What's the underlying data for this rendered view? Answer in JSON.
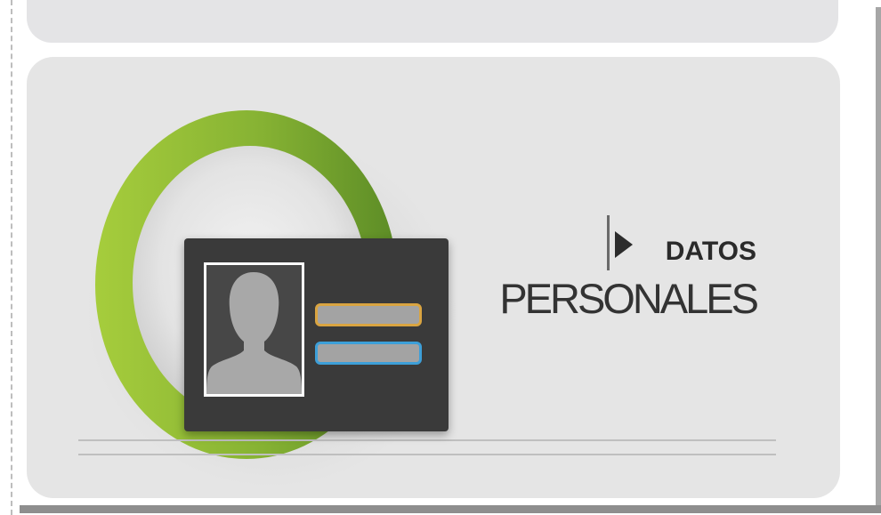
{
  "section": {
    "title_prefix": "DATOS",
    "title_main": "PERSONALES"
  },
  "icons": {
    "ring": "green-ring-icon",
    "card": "id-card-icon",
    "avatar": "person-silhouette-icon",
    "arrow": "play-arrow-icon"
  },
  "colors": {
    "ring_light": "#9cc43b",
    "ring_dark": "#5e8f27",
    "card_bg": "#3a3a3a",
    "field_orange": "#d9a441",
    "field_blue": "#3d9fd8",
    "panel_bg": "#e5e5e5"
  }
}
